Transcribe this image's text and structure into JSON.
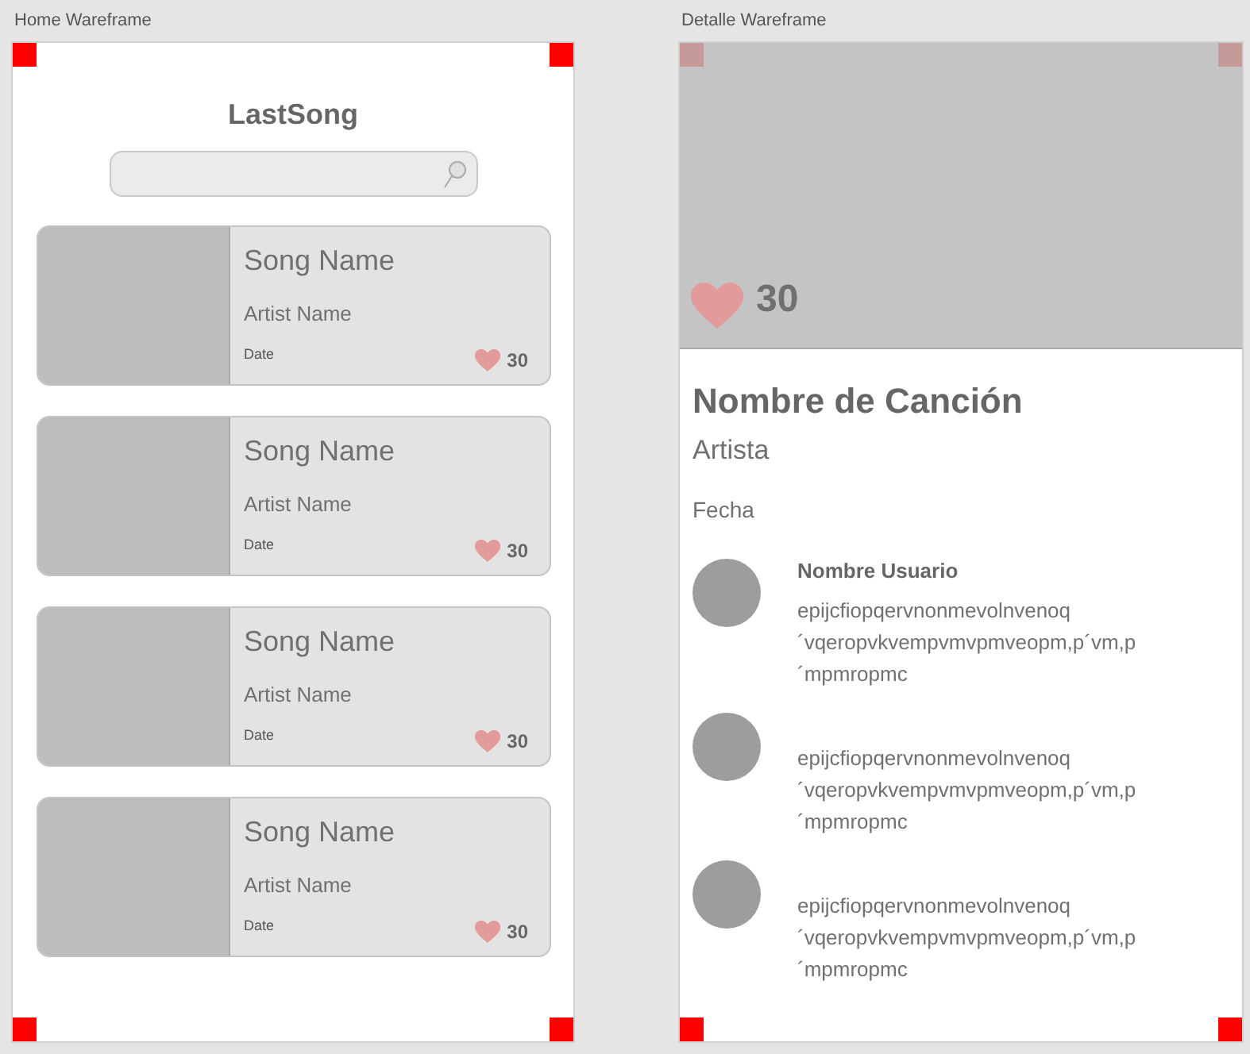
{
  "artboards": [
    {
      "kind": "home",
      "title": "Home Wareframe",
      "app_title": "LastSong",
      "songs": [
        {
          "name": "Song Name",
          "artist": "Artist Name",
          "date": "Date",
          "likes": "30"
        },
        {
          "name": "Song Name",
          "artist": "Artist Name",
          "date": "Date",
          "likes": "30"
        },
        {
          "name": "Song Name",
          "artist": "Artist Name",
          "date": "Date",
          "likes": "30"
        },
        {
          "name": "Song Name",
          "artist": "Artist Name",
          "date": "Date",
          "likes": "30"
        }
      ]
    },
    {
      "kind": "detail",
      "title": "Detalle Wareframe",
      "likes": "30",
      "song_title": "Nombre de Canción",
      "artist": "Artista",
      "date": "Fecha",
      "comments": [
        {
          "user": "Nombre Usuario",
          "text": "epijcfiopqervnonmevolnvenoq\n´vqeropvkvempvmvpmveopm,p´vm,p\n´mpmropmc"
        },
        {
          "text": "epijcfiopqervnonmevolnvenoq\n´vqeropvkvempvmvpmveopm,p´vm,p\n´mpmropmc"
        },
        {
          "text": "epijcfiopqervnonmevolnvenoq\n´vqeropvkvempvmvpmveopm,p´vm,p\n´mpmropmc"
        }
      ]
    }
  ]
}
